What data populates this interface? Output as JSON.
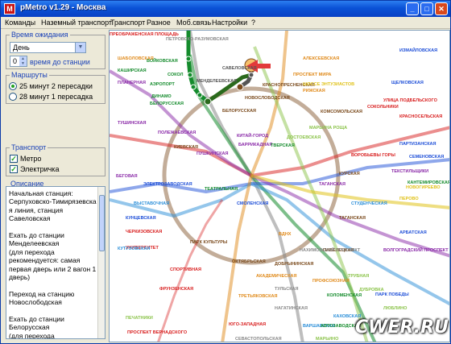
{
  "window": {
    "title": "pMetro v1.29 - Москва",
    "icon_letter": "M"
  },
  "menu": [
    "Команды",
    "Наземный транспорт",
    "Транспорт",
    "Разное",
    "Моб.связь",
    "Настройки",
    "?"
  ],
  "left": {
    "wait_group": {
      "title": "Время ожидания",
      "day_value": "День",
      "time_value": "0",
      "time_label": "время до станции"
    },
    "routes_group": {
      "title": "Маршруты",
      "options": [
        {
          "label": "25 минут 2 пересадки",
          "selected": true
        },
        {
          "label": "28 минут 1 пересадка",
          "selected": false
        }
      ]
    },
    "transport_group": {
      "title": "Транспорт",
      "items": [
        {
          "label": "Метро",
          "checked": true
        },
        {
          "label": "Электричка",
          "checked": true
        }
      ]
    },
    "description": {
      "title": "Описание",
      "lines": [
        "Начальная станция:",
        "Серпуховско-Тимирязевска",
        "я линия, станция",
        "Савеловская",
        "",
        "Ехать до станции",
        "Менделеевская",
        "(для перехода",
        "рекомендуется: самая",
        "первая дверь или 2 вагон 1",
        "дверь)",
        "",
        "Переход на станцию",
        "Новослободская",
        "",
        "Ехать до станции",
        "Белорусская",
        "(для перехода"
      ]
    }
  },
  "map": {
    "labels": [
      {
        "text": "ПЕТРОВСКО-РАЗУМОВСКАЯ",
        "c": "#888"
      },
      {
        "text": "ВОЙКОВСКАЯ",
        "c": "#148b2c"
      },
      {
        "text": "СОКОЛ",
        "c": "#148b2c"
      },
      {
        "text": "АЭРОПОРТ",
        "c": "#148b2c"
      },
      {
        "text": "ДИНАМО",
        "c": "#148b2c"
      },
      {
        "text": "БЕЛОРУССКАЯ",
        "c": "#148b2c"
      },
      {
        "text": "САВЕЛОВСКАЯ",
        "c": "#555"
      },
      {
        "text": "МЕНДЕЛЕЕВСКАЯ",
        "c": "#555"
      },
      {
        "text": "НОВОСЛОБОДСКАЯ",
        "c": "#7a4a1c"
      },
      {
        "text": "БЕЛОРУССКАЯ",
        "c": "#7a4a1c"
      },
      {
        "text": "КОМСОМОЛЬСКАЯ",
        "c": "#7a4a1c"
      },
      {
        "text": "КУРСКАЯ",
        "c": "#7a4a1c"
      },
      {
        "text": "ТАГАНСКАЯ",
        "c": "#7a4a1c"
      },
      {
        "text": "ПАВЕЛЕЦКАЯ",
        "c": "#7a4a1c"
      },
      {
        "text": "ДОБРЫНИНСКАЯ",
        "c": "#7a4a1c"
      },
      {
        "text": "ОКТЯБРЬСКАЯ",
        "c": "#7a4a1c"
      },
      {
        "text": "ПАРК КУЛЬТУРЫ",
        "c": "#7a4a1c"
      },
      {
        "text": "КИЕВСКАЯ",
        "c": "#7a4a1c"
      },
      {
        "text": "КРАСНОПРЕСНЕНСКАЯ",
        "c": "#7a4a1c"
      },
      {
        "text": "ПРОСПЕКТ МИРА",
        "c": "#e08a1a"
      },
      {
        "text": "РИЖСКАЯ",
        "c": "#e08a1a"
      },
      {
        "text": "АЛЕКСЕЕВСКАЯ",
        "c": "#e08a1a"
      },
      {
        "text": "ВДНХ",
        "c": "#e08a1a"
      },
      {
        "text": "ТРЕТЬЯКОВСКАЯ",
        "c": "#e08a1a"
      },
      {
        "text": "ТУЛЬСКАЯ",
        "c": "#888"
      },
      {
        "text": "НАГАТИНСКАЯ",
        "c": "#888"
      },
      {
        "text": "ВАРШАВСКАЯ",
        "c": "#2a8ed8"
      },
      {
        "text": "КАХОВСКАЯ",
        "c": "#2a8ed8"
      },
      {
        "text": "КОЛОМЕНСКАЯ",
        "c": "#148b2c"
      },
      {
        "text": "КАШИРСКАЯ",
        "c": "#148b2c"
      },
      {
        "text": "СОКОЛЬНИКИ",
        "c": "#d81e1e"
      },
      {
        "text": "КРАСНОСЕЛЬСКАЯ",
        "c": "#d81e1e"
      },
      {
        "text": "ЧЕРКИЗОВСКАЯ",
        "c": "#d81e1e"
      },
      {
        "text": "УНИВЕРСИТЕТ",
        "c": "#d81e1e"
      },
      {
        "text": "СПОРТИВНАЯ",
        "c": "#d81e1e"
      },
      {
        "text": "ФРУНЗЕНСКАЯ",
        "c": "#d81e1e"
      },
      {
        "text": "ВОРОБЬЕВЫ ГОРЫ",
        "c": "#d81e1e"
      },
      {
        "text": "ПАРТИЗАНСКАЯ",
        "c": "#1e4fd8"
      },
      {
        "text": "СЕМЕНОВСКАЯ",
        "c": "#1e4fd8"
      },
      {
        "text": "ЭЛЕКТРОЗАВОДСКАЯ",
        "c": "#1e4fd8"
      },
      {
        "text": "ВЫСТАВОЧНАЯ",
        "c": "#2a8ed8"
      },
      {
        "text": "КУТУЗОВСКАЯ",
        "c": "#2a8ed8"
      },
      {
        "text": "СТУДЕНЧЕСКАЯ",
        "c": "#2a8ed8"
      },
      {
        "text": "ТАГАНСКАЯ",
        "c": "#8a2aa8"
      },
      {
        "text": "КИТАЙ-ГОРОД",
        "c": "#8a2aa8"
      },
      {
        "text": "ПУШКИНСКАЯ",
        "c": "#8a2aa8"
      },
      {
        "text": "БАРРИКАДНАЯ",
        "c": "#8a2aa8"
      },
      {
        "text": "ТВЕРСКАЯ",
        "c": "#148b2c"
      },
      {
        "text": "ТЕАТРАЛЬНАЯ",
        "c": "#148b2c"
      },
      {
        "text": "СМОЛЕНСКАЯ",
        "c": "#1e4fd8"
      },
      {
        "text": "АРБАТСКАЯ",
        "c": "#1e4fd8"
      },
      {
        "text": "ВОЛГОГРАДСКИЙ ПРОСПЕКТ",
        "c": "#8a2aa8"
      },
      {
        "text": "ТЕКСТИЛЬЩИКИ",
        "c": "#8a2aa8"
      },
      {
        "text": "НОВОГИРЕЕВО",
        "c": "#e0c21a"
      },
      {
        "text": "ПЕРОВО",
        "c": "#e0c21a"
      },
      {
        "text": "ШОССЕ ЭНТУЗИАСТОВ",
        "c": "#e0c21a"
      },
      {
        "text": "МАРЬИНА РОЩА",
        "c": "#8bc34a"
      },
      {
        "text": "ДОСТОЕВСКАЯ",
        "c": "#8bc34a"
      },
      {
        "text": "ТРУБНАЯ",
        "c": "#8bc34a"
      },
      {
        "text": "ДУБРОВКА",
        "c": "#8bc34a"
      },
      {
        "text": "ПЕЧАТНИКИ",
        "c": "#8bc34a"
      },
      {
        "text": "ПРОСПЕКТ ВЕРНАДСКОГО",
        "c": "#d81e1e"
      },
      {
        "text": "ЮГО-ЗАПАДНАЯ",
        "c": "#d81e1e"
      },
      {
        "text": "СЕВАСТОПОЛЬСКАЯ",
        "c": "#888"
      },
      {
        "text": "НАХИМОВСКИЙ ПРОСПЕКТ",
        "c": "#888"
      },
      {
        "text": "ПРОФСОЮЗНАЯ",
        "c": "#e08a1a"
      },
      {
        "text": "АКАДЕМИЧЕСКАЯ",
        "c": "#e08a1a"
      },
      {
        "text": "ШАБОЛОВСКАЯ",
        "c": "#e08a1a"
      },
      {
        "text": "ПЛАНЕРНАЯ",
        "c": "#8a2aa8"
      },
      {
        "text": "ТУШИНСКАЯ",
        "c": "#8a2aa8"
      },
      {
        "text": "ПОЛЕЖАЕВСКАЯ",
        "c": "#8a2aa8"
      },
      {
        "text": "БЕГОВАЯ",
        "c": "#8a2aa8"
      },
      {
        "text": "КУНЦЕВСКАЯ",
        "c": "#1e4fd8"
      },
      {
        "text": "ПАРК ПОБЕДЫ",
        "c": "#1e4fd8"
      },
      {
        "text": "ЛЮБЛИНО",
        "c": "#8bc34a"
      },
      {
        "text": "МАРЬИНО",
        "c": "#8bc34a"
      },
      {
        "text": "АВТОЗАВОДСКАЯ",
        "c": "#148b2c"
      },
      {
        "text": "КАНТЕМИРОВСКАЯ",
        "c": "#148b2c"
      },
      {
        "text": "ЩЕЛКОВСКАЯ",
        "c": "#1e4fd8"
      },
      {
        "text": "ИЗМАЙЛОВСКАЯ",
        "c": "#1e4fd8"
      },
      {
        "text": "УЛИЦА ПОДБЕЛЬСКОГО",
        "c": "#d81e1e"
      },
      {
        "text": "ПРЕОБРАЖЕНСКАЯ ПЛОЩАДЬ",
        "c": "#d81e1e"
      }
    ]
  },
  "watermark": "CWER.RU"
}
